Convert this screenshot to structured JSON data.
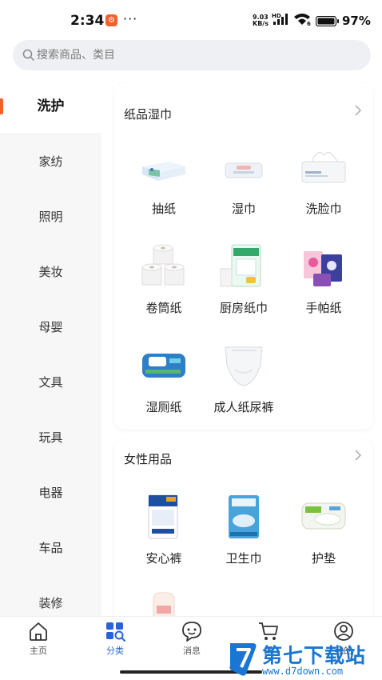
{
  "status_bar": {
    "time": "2:34",
    "app_badge": "⚙",
    "dots": "···",
    "net_speed_value": "9.03",
    "net_speed_unit": "KB/s",
    "signal_label": "HD",
    "wifi_label": "6",
    "battery": "97%"
  },
  "search": {
    "placeholder": "搜索商品、类目"
  },
  "sidebar": {
    "items": [
      {
        "label": "洗护",
        "active": true
      },
      {
        "label": "家纺"
      },
      {
        "label": "照明"
      },
      {
        "label": "美妆"
      },
      {
        "label": "母婴"
      },
      {
        "label": "文具"
      },
      {
        "label": "玩具"
      },
      {
        "label": "电器"
      },
      {
        "label": "车品"
      },
      {
        "label": "装修"
      }
    ]
  },
  "sections": [
    {
      "title": "纸品湿巾",
      "items": [
        {
          "label": "抽纸",
          "icon": "tissue-box-image"
        },
        {
          "label": "湿巾",
          "icon": "wet-wipes-image"
        },
        {
          "label": "洗脸巾",
          "icon": "face-towel-image"
        },
        {
          "label": "卷筒纸",
          "icon": "toilet-roll-image"
        },
        {
          "label": "厨房纸巾",
          "icon": "kitchen-paper-image"
        },
        {
          "label": "手帕纸",
          "icon": "handkerchief-paper-image"
        },
        {
          "label": "湿厕纸",
          "icon": "wet-toilet-paper-image"
        },
        {
          "label": "成人纸尿裤",
          "icon": "adult-diaper-image"
        }
      ]
    },
    {
      "title": "女性用品",
      "items": [
        {
          "label": "安心裤",
          "icon": "safety-pants-image"
        },
        {
          "label": "卫生巾",
          "icon": "sanitary-pad-image"
        },
        {
          "label": "护垫",
          "icon": "panty-liner-image"
        }
      ]
    }
  ],
  "tabbar": {
    "tabs": [
      {
        "label": "主页",
        "icon": "home-icon"
      },
      {
        "label": "分类",
        "icon": "category-icon",
        "active": true
      },
      {
        "label": "消息",
        "icon": "message-icon"
      },
      {
        "label": "采",
        "icon": "cart-icon"
      },
      {
        "label": "我的",
        "icon": "user-icon"
      }
    ]
  },
  "watermark": {
    "title": "第七下载站",
    "url": "www.d7down.com"
  },
  "colors": {
    "accent": "#f0622b",
    "active_tab": "#2a62d8",
    "watermark": "#1976d2"
  }
}
